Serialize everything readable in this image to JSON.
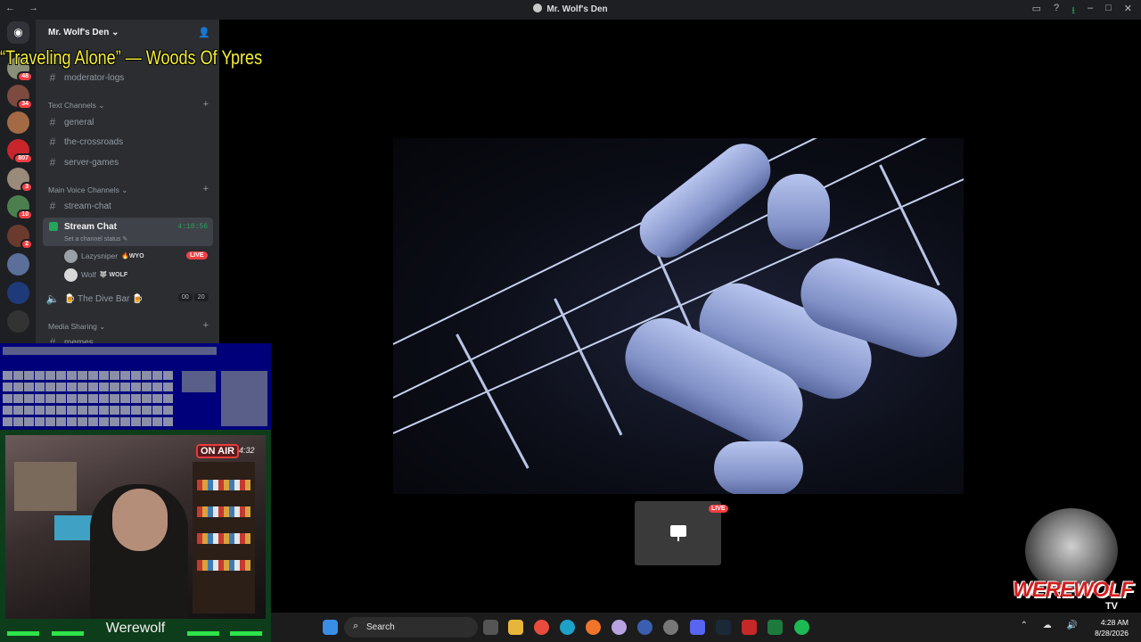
{
  "window": {
    "title": "Mr. Wolf's Den",
    "nav": "← →"
  },
  "song_overlay": "“Traveling Alone” — Woods Of Ypres",
  "server": {
    "name": "Mr. Wolf's Den ⌄",
    "badges": [
      "48",
      "34",
      "807",
      "3",
      "10",
      "2"
    ]
  },
  "channels": {
    "top": [
      {
        "name": "moderator-logs"
      }
    ],
    "text_category": "Text Channels ⌄",
    "text": [
      {
        "name": "general"
      },
      {
        "name": "the-crossroads"
      },
      {
        "name": "server-games"
      }
    ],
    "voice_category": "Main Voice Channels ⌄",
    "voice_text": {
      "name": "stream-chat"
    },
    "active_voice": {
      "name": "Stream Chat",
      "status": "Set a channel status ✎",
      "timer": "4:18:56",
      "users": [
        {
          "name": "Lazysniper",
          "tag": "🔥WYO",
          "live": "LIVE"
        },
        {
          "name": "Wolf",
          "tag": "🐺 WOLF"
        }
      ]
    },
    "dive_bar": {
      "name": "🍺 The Dive Bar 🍺",
      "count_a": "00",
      "count_b": "20"
    },
    "media_category": "Media Sharing ⌄",
    "media_first": "memes"
  },
  "webcam": {
    "onair": "ON AIR",
    "time": "4:32",
    "name": "Werewolf"
  },
  "stream": {
    "preview_live": "LIVE"
  },
  "logo": {
    "text": "WEREWOLF",
    "tv": "TV"
  },
  "taskbar": {
    "search": "Search",
    "time": "4:28 AM",
    "date": "8/28/2026"
  }
}
